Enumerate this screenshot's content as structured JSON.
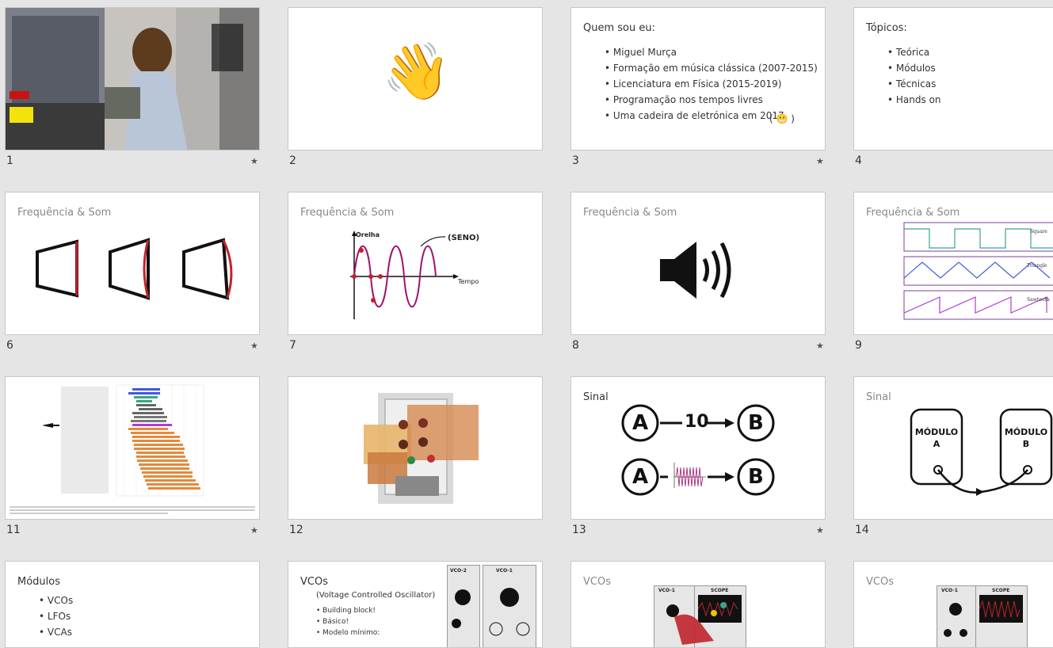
{
  "slides": [
    {
      "n": "1",
      "starred": true
    },
    {
      "n": "2",
      "emoji": "👋"
    },
    {
      "n": "3",
      "starred": true,
      "title": "Quem sou eu:",
      "bullets": [
        "Miguel Murça",
        "Formação em música clássica (2007-2015)",
        "Licenciatura em Física (2015-2019)",
        "Programação nos tempos livres",
        "Uma cadeira de eletrónica em 2017"
      ],
      "paren": "( 😬 )"
    },
    {
      "n": "4",
      "title": "Tópicos:",
      "bullets": [
        "Teórica",
        "Módulos",
        "Técnicas",
        "Hands on"
      ]
    },
    {
      "n": "6",
      "starred": true,
      "title": "Frequência & Som"
    },
    {
      "n": "7",
      "title": "Frequência & Som",
      "labels": {
        "ear": "Orelha",
        "sine": "(SENO)",
        "time": "Tempo"
      }
    },
    {
      "n": "8",
      "starred": true,
      "title": "Frequência & Som"
    },
    {
      "n": "9",
      "title": "Frequência & Som",
      "waves": [
        "Square",
        "Triangle",
        "Sawtooth"
      ]
    },
    {
      "n": "11",
      "starred": true
    },
    {
      "n": "12"
    },
    {
      "n": "13",
      "starred": true,
      "title": "Sinal",
      "value": "10"
    },
    {
      "n": "14",
      "title": "Sinal",
      "modA": [
        "MÓDULO",
        "A"
      ],
      "modB": [
        "MÓDULO",
        "B"
      ]
    },
    {
      "title": "Módulos",
      "bullets": [
        "VCOs",
        "LFOs",
        "VCAs"
      ]
    },
    {
      "title": "VCOs",
      "subtitle": "(Voltage Controlled Oscillator)",
      "bullets": [
        "Building block!",
        "Básico!",
        "Modelo mínimo:"
      ],
      "panels": [
        "VCO-2",
        "VCO-1"
      ]
    },
    {
      "title": "VCOs",
      "panels": [
        "VCO-1",
        "SCOPE"
      ]
    },
    {
      "title": "VCOs",
      "panels": [
        "VCO-1",
        "SCOPE"
      ]
    }
  ],
  "star_glyph": "★",
  "colors": {
    "accent": "#c0232c",
    "wave": "#a0146e",
    "green": "#3aa58a",
    "blue": "#3f5ad8",
    "purple": "#b23bd6"
  }
}
